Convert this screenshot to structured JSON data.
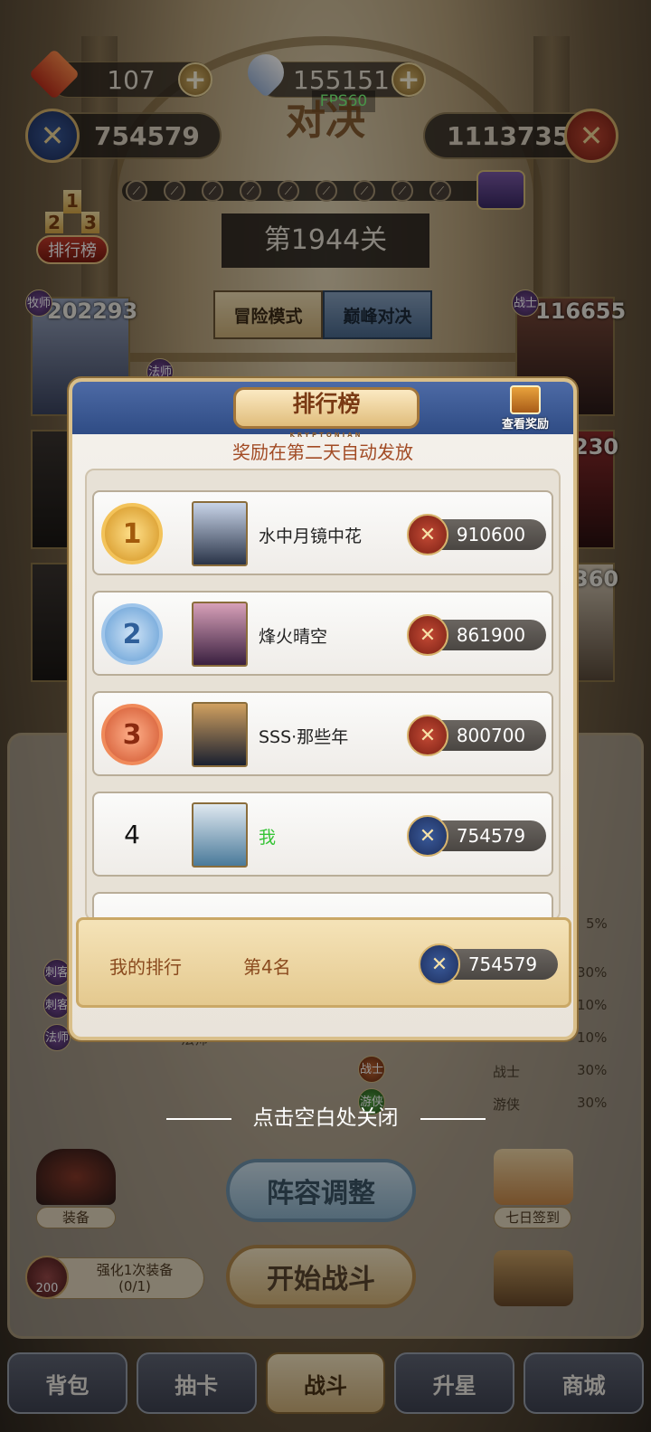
{
  "resources": {
    "energy": "107",
    "gems": "155151"
  },
  "fps": "FPS60",
  "match": {
    "title": "对决",
    "my_power": "754579",
    "enemy_power": "1113735"
  },
  "stage": "第1944关",
  "rank_badge": {
    "cups": [
      "1",
      "2",
      "3"
    ],
    "label": "排行榜"
  },
  "modes": [
    "冒险模式",
    "巅峰对决"
  ],
  "heroes_left": [
    {
      "num": "202293",
      "class": "牧师"
    },
    {
      "num": "",
      "class": "法师"
    }
  ],
  "heroes_right": [
    {
      "num": "116655",
      "class": "战士"
    },
    {
      "num": "230",
      "class": ""
    },
    {
      "num": "360",
      "class": ""
    }
  ],
  "leaderboard": {
    "title": "排行榜",
    "subtitle": "KRYPTONIAN",
    "reward_button": "查看奖励",
    "notice": "奖励在第二天自动发放",
    "rows": [
      {
        "rank": "1",
        "name": "水中月镜中花",
        "score": "910600"
      },
      {
        "rank": "2",
        "name": "烽火晴空",
        "score": "861900"
      },
      {
        "rank": "3",
        "name": "SSS·那些年",
        "score": "800700"
      },
      {
        "rank": "4",
        "name": "我",
        "score": "754579"
      }
    ],
    "my_rank": {
      "label": "我的排行",
      "position": "第4名",
      "score": "754579"
    }
  },
  "close_hint": "点击空白处关闭",
  "stats_right": [
    {
      "pct": "5%"
    },
    {
      "pct": "30%"
    },
    {
      "pct": "10%"
    },
    {
      "name": "",
      "pct": "10%"
    },
    {
      "name": "战士",
      "pct": "30%"
    },
    {
      "name": "游侠",
      "pct": "30%"
    }
  ],
  "stats_left_pct": "30%",
  "stats_left_class": "法师",
  "left_tags": [
    "刺客",
    "刺客",
    "法师"
  ],
  "right_tags": [
    "战士",
    "游侠"
  ],
  "buttons": {
    "adjust": "阵容调整",
    "start": "开始战斗"
  },
  "side": {
    "equip": "装备",
    "signin": "七日签到",
    "upgrade_task": "强化1次装备",
    "upgrade_progress": "(0/1)",
    "upgrade_badge": "200"
  },
  "nav": [
    "背包",
    "抽卡",
    "战斗",
    "升星",
    "商城"
  ]
}
